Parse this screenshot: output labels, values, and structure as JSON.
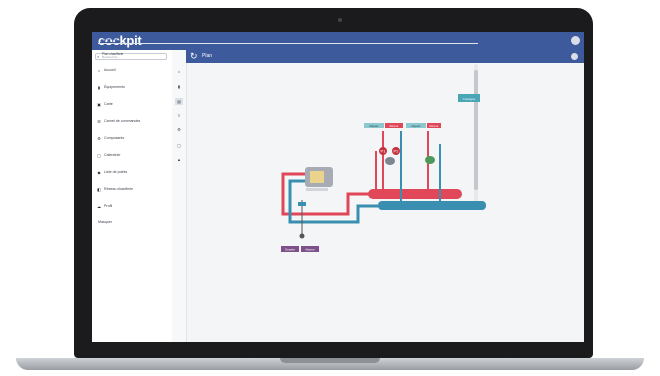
{
  "app": {
    "brand": "cockpit"
  },
  "sidebar": {
    "search_placeholder": "Rechercher ...",
    "items": [
      {
        "label": "Accueil",
        "icon": "home-icon"
      },
      {
        "label": "Équipements",
        "icon": "building-icon"
      },
      {
        "label": "Carte",
        "icon": "map-icon"
      },
      {
        "label": "Carnet de commandes",
        "icon": "list-icon"
      },
      {
        "label": "Composants",
        "icon": "component-icon"
      },
      {
        "label": "Calendrier",
        "icon": "calendar-icon"
      },
      {
        "label": "Liste de points",
        "icon": "points-icon"
      },
      {
        "label": "Réseau chaufferie",
        "icon": "network-icon"
      },
      {
        "label": "Profil",
        "icon": "profile-icon"
      }
    ],
    "footer": "Masquer"
  },
  "page": {
    "title": "Plan",
    "tab": "Synoptique",
    "breadcrumb": "Plan chaufferie"
  },
  "diagram": {
    "colors": {
      "hot": "#e0485a",
      "cold": "#3a8fb0",
      "purple": "#7e4f8a",
      "teal": "#4aa6b7"
    },
    "tag_top_right": "Consigne",
    "left_group": [
      "Départ",
      "Retour"
    ],
    "right_group": [
      "Départ",
      "Retour"
    ],
    "pump_labels": [
      "P1",
      "P2"
    ],
    "bottom_buttons": [
      "Graphe",
      "Alarme"
    ]
  }
}
